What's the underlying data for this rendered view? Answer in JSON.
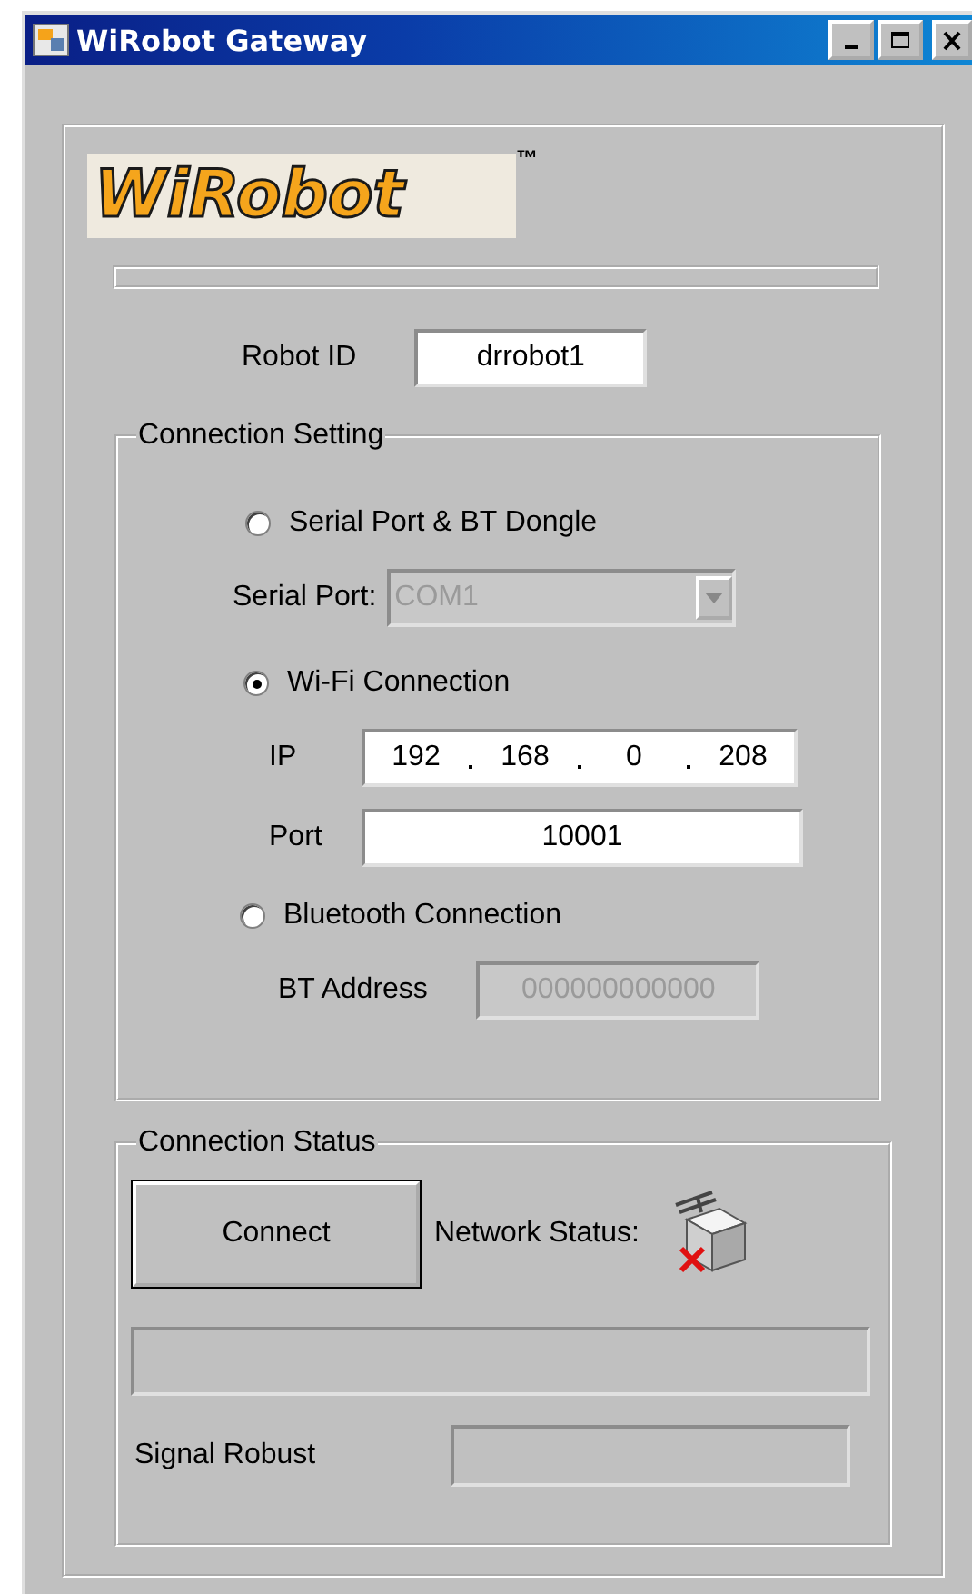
{
  "window": {
    "title": "WiRobot Gateway"
  },
  "logo": {
    "text": "WiRobot",
    "mark": "™"
  },
  "progress": {
    "level": 0
  },
  "robot_id": {
    "label": "Robot ID",
    "value": "drrobot1"
  },
  "connection_setting": {
    "title": "Connection Setting",
    "rows": [
      {
        "kind": "radio",
        "label": "Serial Port  & BT Dongle",
        "selected": false
      },
      {
        "kind": "combo",
        "label": "Serial Port:",
        "value": "COM1",
        "disabled": true
      },
      {
        "kind": "radio",
        "label": "Wi-Fi Connection",
        "selected": true
      },
      {
        "kind": "ip",
        "label": "IP",
        "octets": [
          "192",
          "168",
          "0",
          "208"
        ],
        "disabled": false
      },
      {
        "kind": "text",
        "label": "Port",
        "value": "10001",
        "disabled": false
      },
      {
        "kind": "radio",
        "label": "Bluetooth Connection",
        "selected": false
      },
      {
        "kind": "address",
        "label": "BT  Address",
        "value": "000000000000",
        "disabled": true
      }
    ]
  },
  "connection_status": {
    "title": "Connection Status",
    "button": "Connect",
    "network_label": "Network Status:",
    "signal_label": "Signal Robust"
  }
}
